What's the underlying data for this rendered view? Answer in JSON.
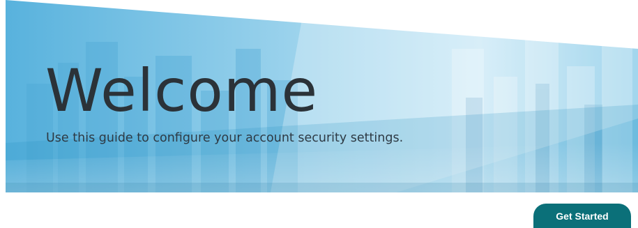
{
  "hero": {
    "title": "Welcome",
    "subtitle": "Use this guide to configure your account security settings.",
    "background_image": "city-skyline-illustration"
  },
  "actions": {
    "get_started_label": "Get Started"
  },
  "colors": {
    "hero_tint": "#5ab4df",
    "button_bg": "#0b7079",
    "button_text": "#ffffff",
    "title_text": "#2b3238"
  }
}
